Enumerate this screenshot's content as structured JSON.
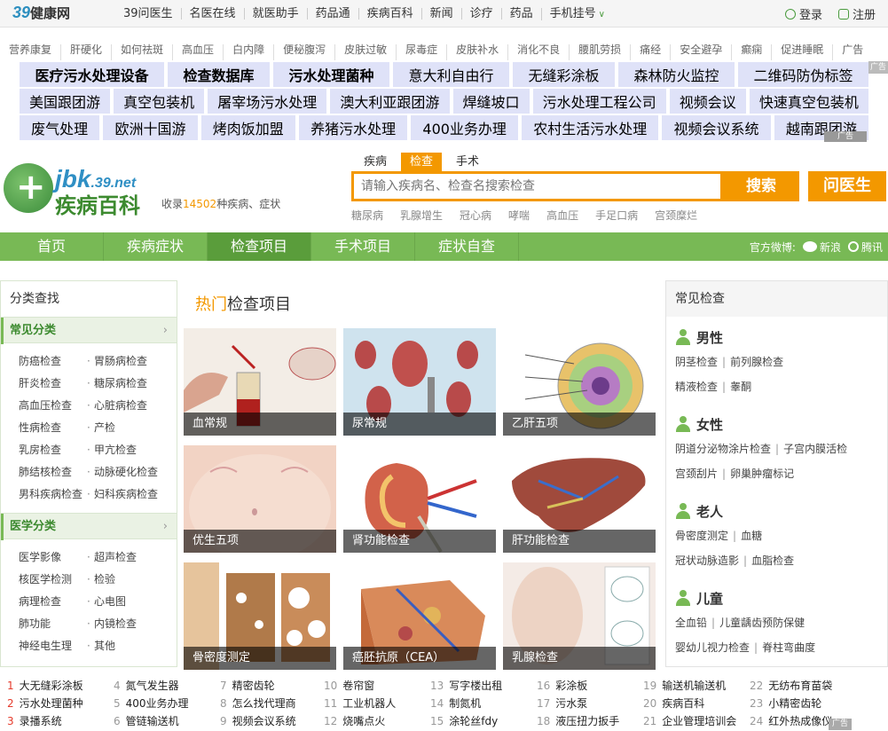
{
  "topbar": {
    "logo_num": "39",
    "logo_text": "健康网",
    "nav": [
      "39问医生",
      "名医在线",
      "就医助手",
      "药品通",
      "疾病百科",
      "新闻",
      "诊疗",
      "药品",
      "手机挂号"
    ],
    "login": "登录",
    "register": "注册"
  },
  "ads": {
    "line": [
      "营养康复",
      "肝硬化",
      "如何祛斑",
      "高血压",
      "白内障",
      "便秘腹泻",
      "皮肤过敏",
      "尿毒症",
      "皮肤补水",
      "消化不良",
      "腰肌劳损",
      "痛经",
      "安全避孕",
      "癫痫",
      "促进睡眠",
      "广告"
    ],
    "rows": [
      [
        "医疗污水处理设备",
        "检查数据库",
        "污水处理菌种",
        "意大利自由行",
        "无缝彩涂板",
        "森林防火监控",
        "二维码防伪标签"
      ],
      [
        "美国跟团游",
        "真空包装机",
        "屠宰场污水处理",
        "澳大利亚跟团游",
        "焊缝坡口",
        "污水处理工程公司",
        "视频会议",
        "快速真空包装机"
      ],
      [
        "废气处理",
        "欧洲十国游",
        "烤肉饭加盟",
        "养猪污水处理",
        "400业务办理",
        "农村生活污水处理",
        "视频会议系统",
        "越南跟团游"
      ]
    ],
    "tag1": "广告",
    "tag2": "广告"
  },
  "brand": {
    "jbk": "jbk",
    "domain": ".39.net",
    "name": "疾病百科",
    "count_pre": "收录",
    "count_num": "14502",
    "count_post": "种疾病、症状"
  },
  "search": {
    "tabs": [
      "疾病",
      "检查",
      "手术"
    ],
    "placeholder": "请输入疾病名、检查名搜索检查",
    "button": "搜索",
    "ask": "问医生",
    "hot": [
      "糖尿病",
      "乳腺增生",
      "冠心病",
      "哮喘",
      "高血压",
      "手足口病",
      "宫颈糜烂"
    ]
  },
  "nav": {
    "items": [
      "首页",
      "疾病症状",
      "检查项目",
      "手术项目",
      "症状自查"
    ],
    "weibo_label": "官方微博:",
    "sina": "新浪",
    "qq": "腾讯"
  },
  "left": {
    "title": "分类查找",
    "sec1": "常见分类",
    "list1": [
      "防癌检查",
      "胃肠病检查",
      "肝炎检查",
      "糖尿病检查",
      "高血压检查",
      "心脏病检查",
      "性病检查",
      "产检",
      "乳房检查",
      "甲亢检查",
      "肺结核检查",
      "动脉硬化检查",
      "男科疾病检查",
      "妇科疾病检查"
    ],
    "sec2": "医学分类",
    "list2": [
      "医学影像",
      "超声检查",
      "核医学检测",
      "检验",
      "病理检查",
      "心电图",
      "肺功能",
      "内镜检查",
      "神经电生理",
      "其他"
    ]
  },
  "mid": {
    "title_hot": "热门",
    "title_rest": "检查项目",
    "tiles": [
      "血常规",
      "尿常规",
      "乙肝五项",
      "优生五项",
      "肾功能检查",
      "肝功能检查",
      "骨密度测定",
      "癌胚抗原（CEA）",
      "乳腺检查"
    ]
  },
  "right": {
    "title": "常见检查",
    "groups": [
      {
        "name": "男性",
        "lines": [
          [
            "阴茎检查",
            "前列腺检查"
          ],
          [
            "精液检查",
            "睾酮"
          ]
        ]
      },
      {
        "name": "女性",
        "lines": [
          [
            "阴道分泌物涂片检查",
            "子宫内膜活检"
          ],
          [
            "宫颈刮片",
            "卵巢肿瘤标记"
          ]
        ]
      },
      {
        "name": "老人",
        "lines": [
          [
            "骨密度测定",
            "血糖"
          ],
          [
            "冠状动脉造影",
            "血脂检查"
          ]
        ]
      },
      {
        "name": "儿童",
        "lines": [
          [
            "全血铅",
            "儿童龋齿预防保健"
          ],
          [
            "婴幼儿视力检查",
            "脊柱弯曲度"
          ]
        ]
      }
    ]
  },
  "bottom": [
    [
      "1",
      "大无缝彩涂板"
    ],
    [
      "2",
      "污水处理菌种"
    ],
    [
      "3",
      "录播系统"
    ],
    [
      "4",
      "氮气发生器"
    ],
    [
      "5",
      "400业务办理"
    ],
    [
      "6",
      "管链输送机"
    ],
    [
      "7",
      "精密齿轮"
    ],
    [
      "8",
      "怎么找代理商"
    ],
    [
      "9",
      "视频会议系统"
    ],
    [
      "10",
      "卷帘窗"
    ],
    [
      "11",
      "工业机器人"
    ],
    [
      "12",
      "烧嘴点火"
    ],
    [
      "13",
      "写字楼出租"
    ],
    [
      "14",
      "制氮机"
    ],
    [
      "15",
      "涂轮丝fdy"
    ],
    [
      "16",
      "彩涂板"
    ],
    [
      "17",
      "污水泵"
    ],
    [
      "18",
      "液压扭力扳手"
    ],
    [
      "19",
      "输送机输送机"
    ],
    [
      "20",
      "疾病百科"
    ],
    [
      "21",
      "企业管理培训会"
    ],
    [
      "22",
      "无纺布育苗袋"
    ],
    [
      "23",
      "小精密齿轮"
    ],
    [
      "24",
      "红外热成像仪"
    ]
  ],
  "bottom_tag": "广告",
  "colors": {
    "green": "#78b955",
    "orange": "#f39800",
    "ad_bg": "#dfe2f8"
  }
}
